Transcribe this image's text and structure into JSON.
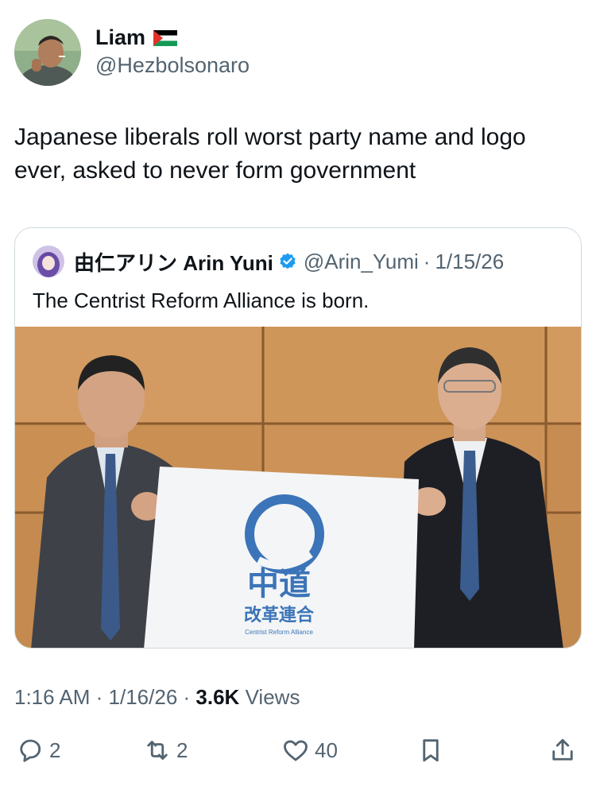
{
  "author": {
    "name": "Liam",
    "handle": "@Hezbolsonaro"
  },
  "tweet": {
    "text": "Japanese liberals roll worst party name and logo ever, asked to never form government"
  },
  "quoted": {
    "name": "由仁アリン Arin Yuni",
    "handle": "@Arin_Yumi",
    "date": "1/15/26",
    "text": "The Centrist Reform Alliance is born.",
    "photo": {
      "sign_main": "中道",
      "sign_sub": "改革連合",
      "sign_small": "Centrist Reform Alliance",
      "logo_color": "#3b74b8"
    }
  },
  "meta": {
    "time": "1:16 AM",
    "date": "1/16/26",
    "views_count": "3.6K",
    "views_label": "Views"
  },
  "actions": {
    "replies": "2",
    "reposts": "2",
    "likes": "40"
  },
  "colors": {
    "text": "#0f1419",
    "secondary": "#536471",
    "border": "#cfd9de",
    "verified": "#1d9bf0"
  }
}
